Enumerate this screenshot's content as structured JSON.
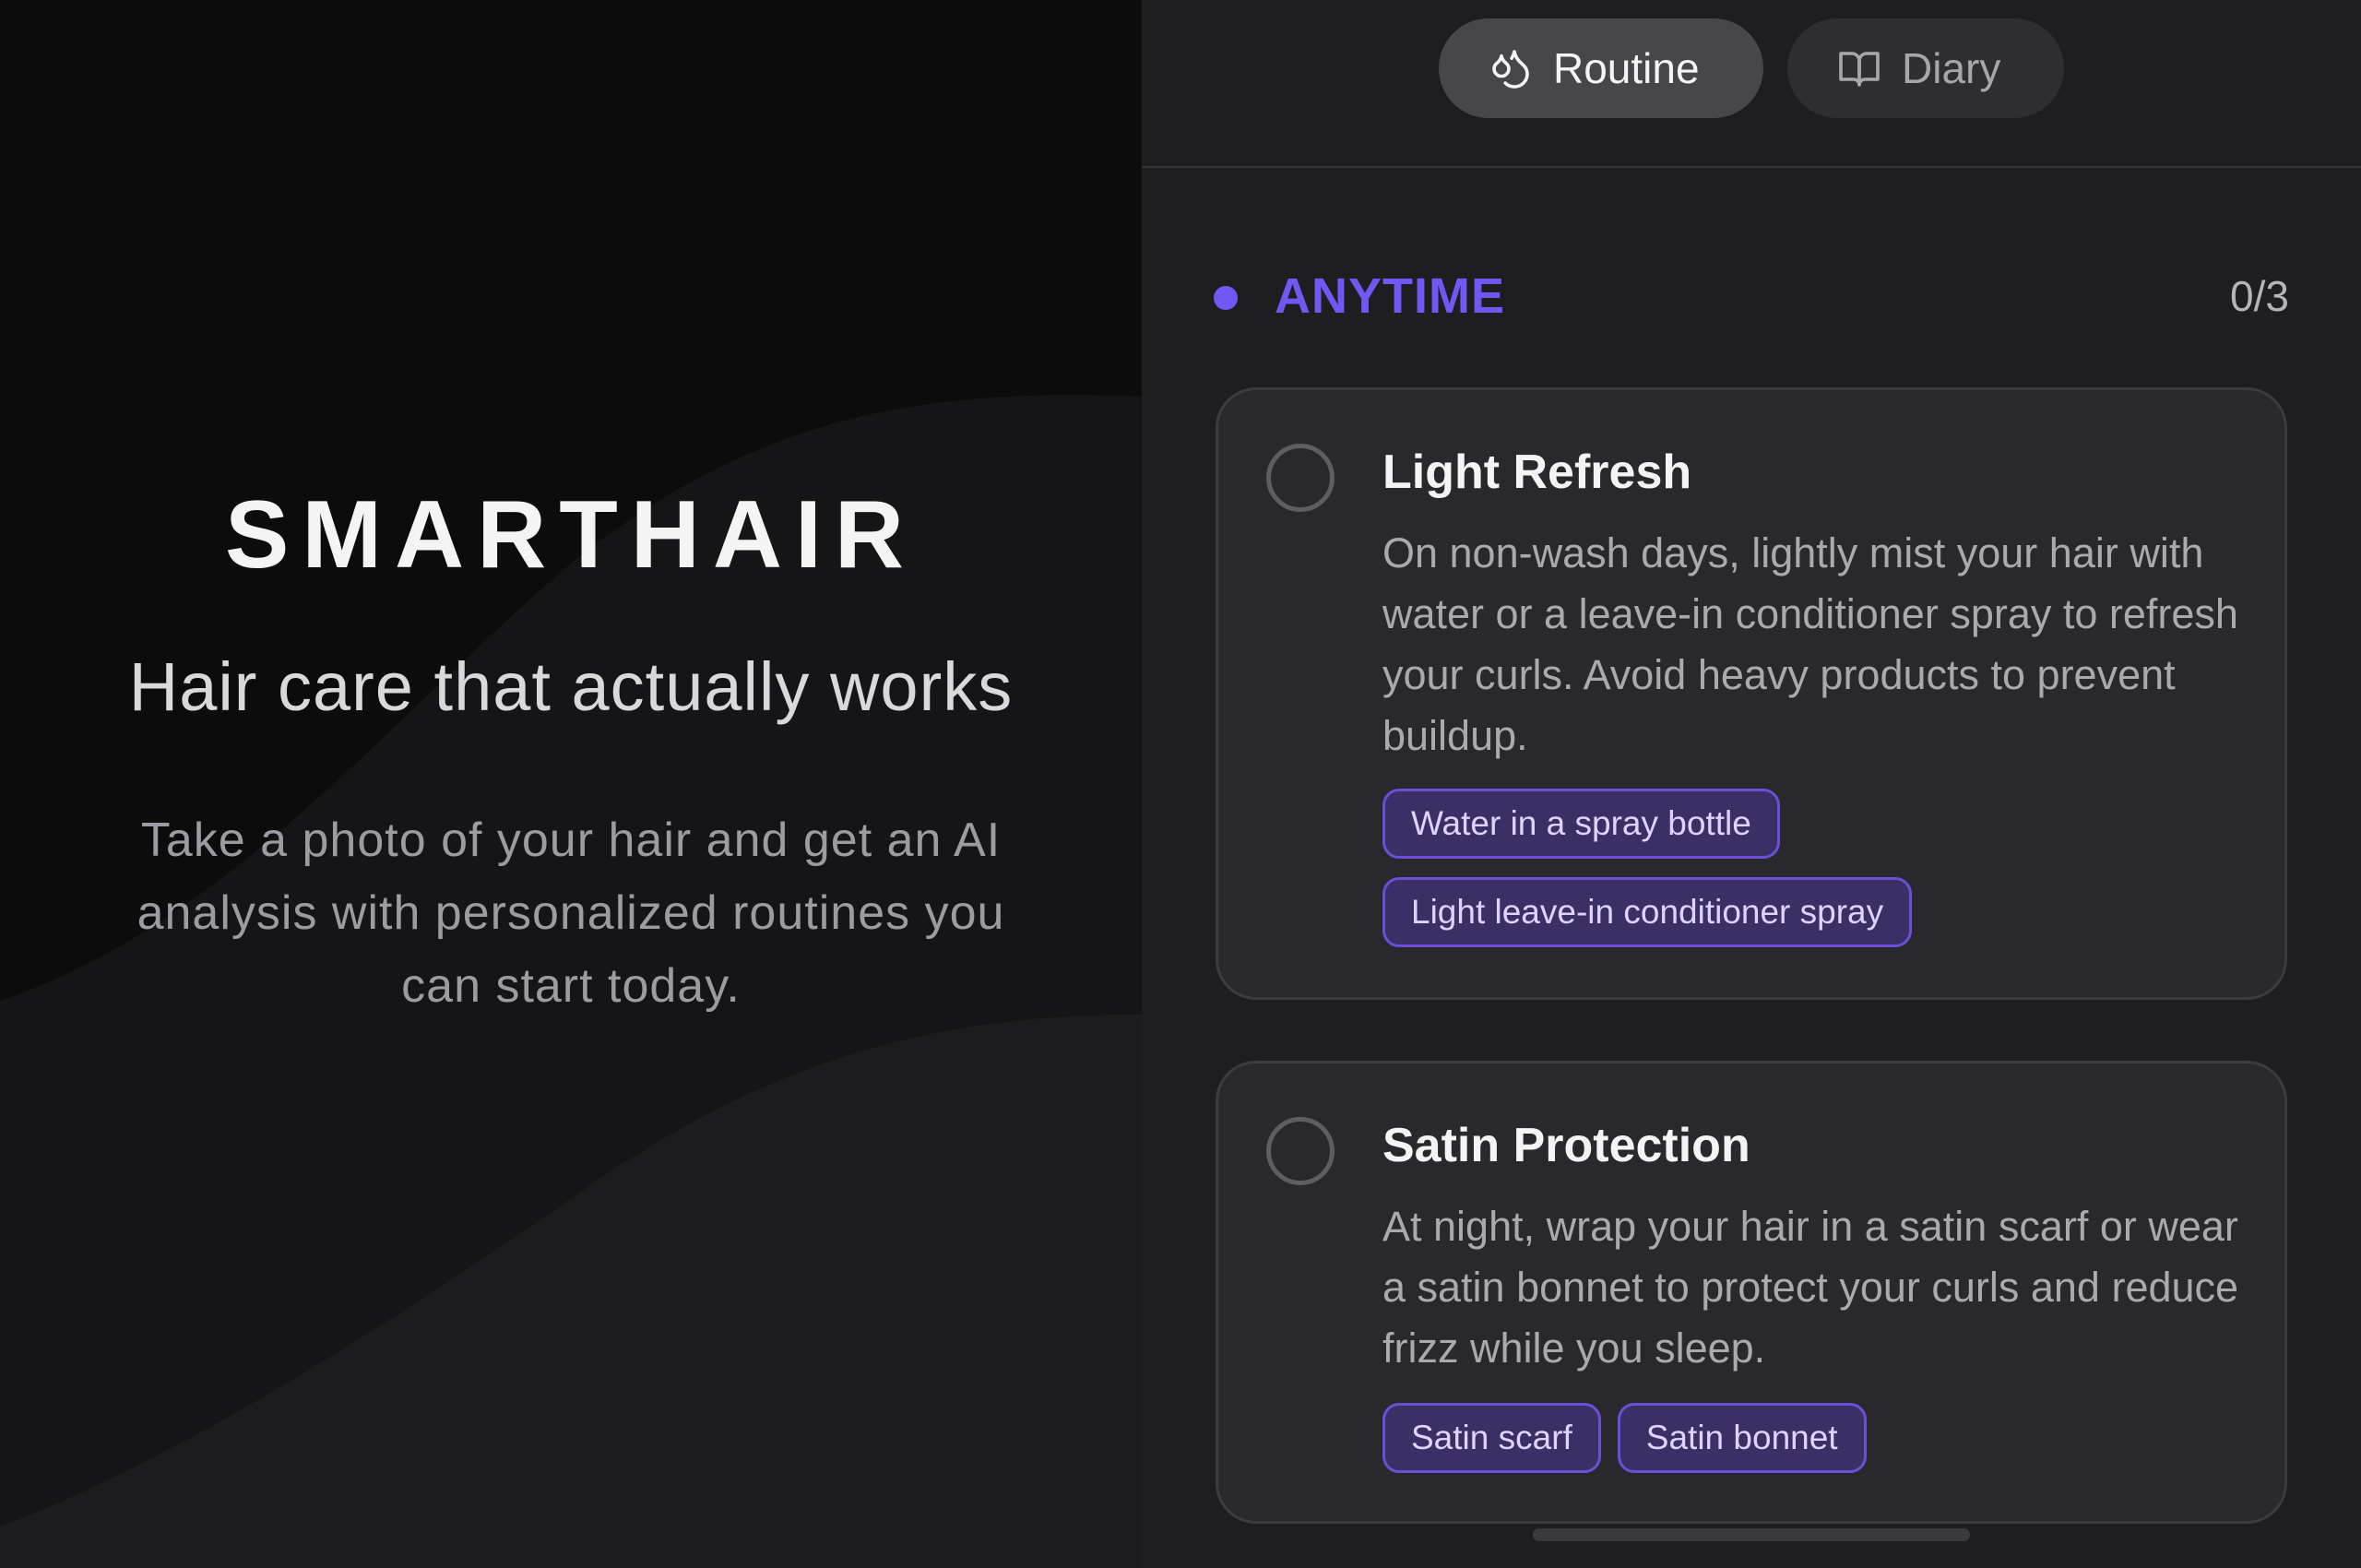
{
  "hero": {
    "brand": "SMARTHAIR",
    "tagline": "Hair care that actually works",
    "description": "Take a photo of your hair and get an AI analysis with personalized routines you can start today."
  },
  "tabs": [
    {
      "label": "Routine",
      "icon": "droplets-icon",
      "active": true
    },
    {
      "label": "Diary",
      "icon": "book-open-icon",
      "active": false
    }
  ],
  "section": {
    "title": "ANYTIME",
    "count": "0/3",
    "accent_color": "#7357f5"
  },
  "tasks": [
    {
      "title": "Light Refresh",
      "description": "On non-wash days, lightly mist your hair with water or a leave-in conditioner spray to refresh your curls. Avoid heavy products to prevent buildup.",
      "tags": [
        "Water in a spray bottle",
        "Light leave-in conditioner spray"
      ],
      "completed": false
    },
    {
      "title": "Satin Protection",
      "description": "At night, wrap your hair in a satin scarf or wear a satin bonnet to protect your curls and reduce frizz while you sleep.",
      "tags": [
        "Satin scarf",
        "Satin bonnet"
      ],
      "completed": false
    }
  ]
}
